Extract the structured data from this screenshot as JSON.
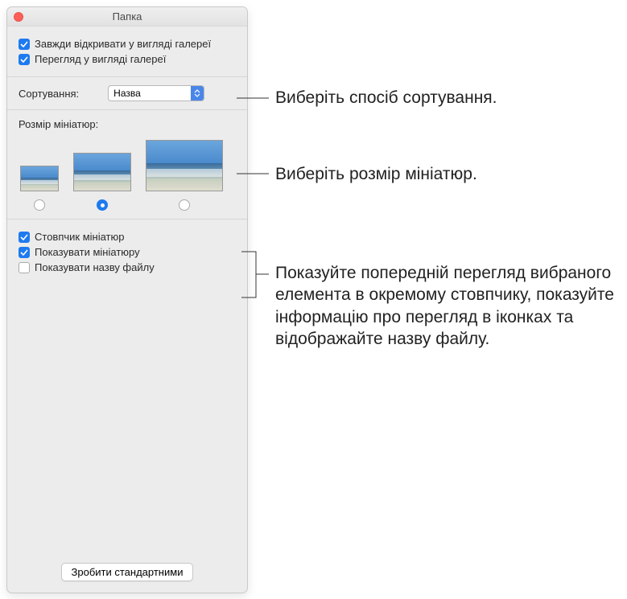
{
  "window": {
    "title": "Папка"
  },
  "checkboxes": {
    "alwaysGallery": {
      "label": "Завжди відкривати у вигляді галереї",
      "checked": true
    },
    "browseGallery": {
      "label": "Перегляд у вигляді галереї",
      "checked": true
    },
    "thumbColumn": {
      "label": "Стовпчик мініатюр",
      "checked": true
    },
    "showThumb": {
      "label": "Показувати мініатюру",
      "checked": true
    },
    "showFilename": {
      "label": "Показувати назву файлу",
      "checked": false
    }
  },
  "sort": {
    "label": "Сортування:",
    "value": "Назва"
  },
  "thumbSize": {
    "label": "Розмір мініатюр:",
    "selectedIndex": 1
  },
  "defaultsButton": "Зробити стандартними",
  "callouts": {
    "sort": "Виберіть спосіб сортування.",
    "size": "Виберіть розмір мініатюр.",
    "options": "Показуйте попередній перегляд вибраного елемента в окремому стовпчику, показуйте інформацію про перегляд в іконках та відображайте назву файлу."
  }
}
